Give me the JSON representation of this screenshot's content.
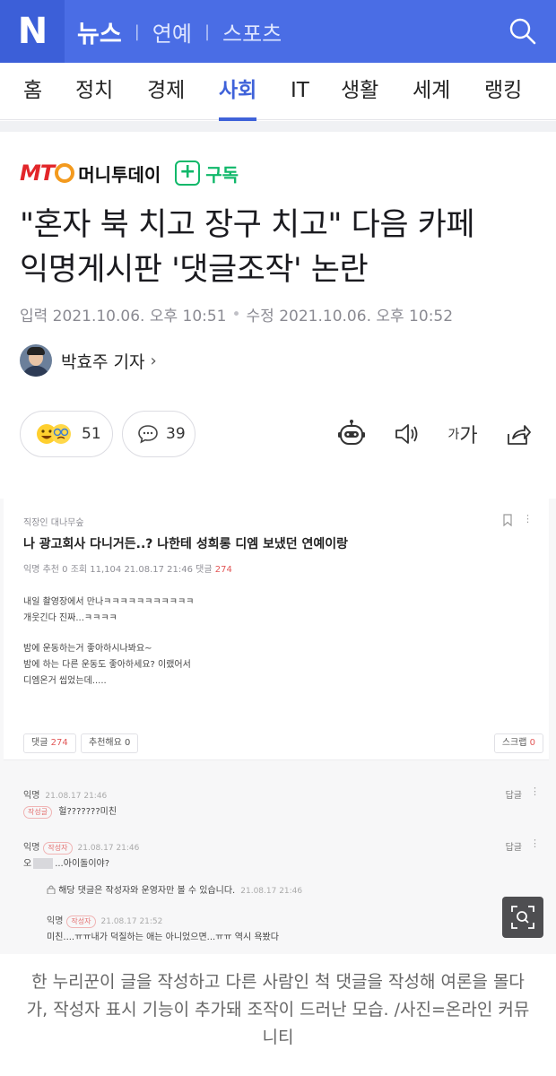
{
  "header": {
    "logo": "N",
    "sections": [
      "뉴스",
      "연예",
      "스포츠"
    ],
    "active_section": "뉴스"
  },
  "category_nav": {
    "items": [
      "홈",
      "정치",
      "경제",
      "사회",
      "IT",
      "생활",
      "세계",
      "랭킹"
    ],
    "active": "사회"
  },
  "press": {
    "logo_text": "MT",
    "name": "머니투데이",
    "subscribe_label": "구독"
  },
  "article": {
    "title_line1": "\"혼자 북 치고 장구 치고\" 다음 카페",
    "title_line2": "익명게시판 '댓글조작' 논란",
    "published": "입력 2021.10.06. 오후 10:51",
    "updated": "수정 2021.10.06. 오후 10:52",
    "reporter": "박효주 기자"
  },
  "reactions": {
    "reaction_count": "51",
    "comment_count": "39",
    "font_small": "가",
    "font_large": "가"
  },
  "photo": {
    "board": "직장인 대나무숲",
    "post_title": "나 광고회사 다니거든..? 나한테 성희롱 디엠 보냈던 연예이랑",
    "meta_prefix": "익명   추천 0   조회 11,104   21.08.17 21:46   댓글",
    "meta_count": "274",
    "body": [
      "내일 촬영장에서 만나ㅋㅋㅋㅋㅋㅋㅋㅋㅋㅋㅋ",
      "개웃긴다 진짜...ㅋㅋㅋㅋ",
      "",
      "밤에 운동하는거 좋아하시나봐요~",
      "밤에 하는 다른 운동도 좋아하세요? 이랬어서",
      "디엠온거 씹었는데....."
    ],
    "btn_comment": "댓글",
    "btn_comment_count": "274",
    "btn_recommend": "추천해요",
    "btn_recommend_count": "0",
    "btn_scrap": "스크랩",
    "btn_scrap_count": "0",
    "comments": [
      {
        "nick": "익명",
        "time": "21.08.17 21:46",
        "badge": "작성글",
        "text": "헐???????미친"
      },
      {
        "nick": "익명",
        "time": "21.08.17 21:46",
        "badge": "작성자",
        "text_before": "오",
        "text_after": "...아이돌이야?"
      },
      {
        "notice": "해당 댓글은 작성자와 운영자만 볼 수 있습니다.",
        "time": "21.08.17 21:46"
      },
      {
        "nick": "익명",
        "time": "21.08.17 21:52",
        "badge": "작성자",
        "text": "미친....ㅠㅠ내가 덕질하는 애는 아니었으면...ㅠㅠ 역시 욕봤다"
      }
    ],
    "reply_label": "답글"
  },
  "caption": "한 누리꾼이 글을 작성하고 다른 사람인 척 댓글을 작성해 여론을 몰다가, 작성자 표시 기능이 추가돼 조작이 드러난 모습. /사진=온라인 커뮤니티",
  "colors": {
    "header_bg": "#4a6de5",
    "accent": "#3f62d9",
    "subscribe": "#10b86a",
    "brand_red": "#e2262a"
  }
}
